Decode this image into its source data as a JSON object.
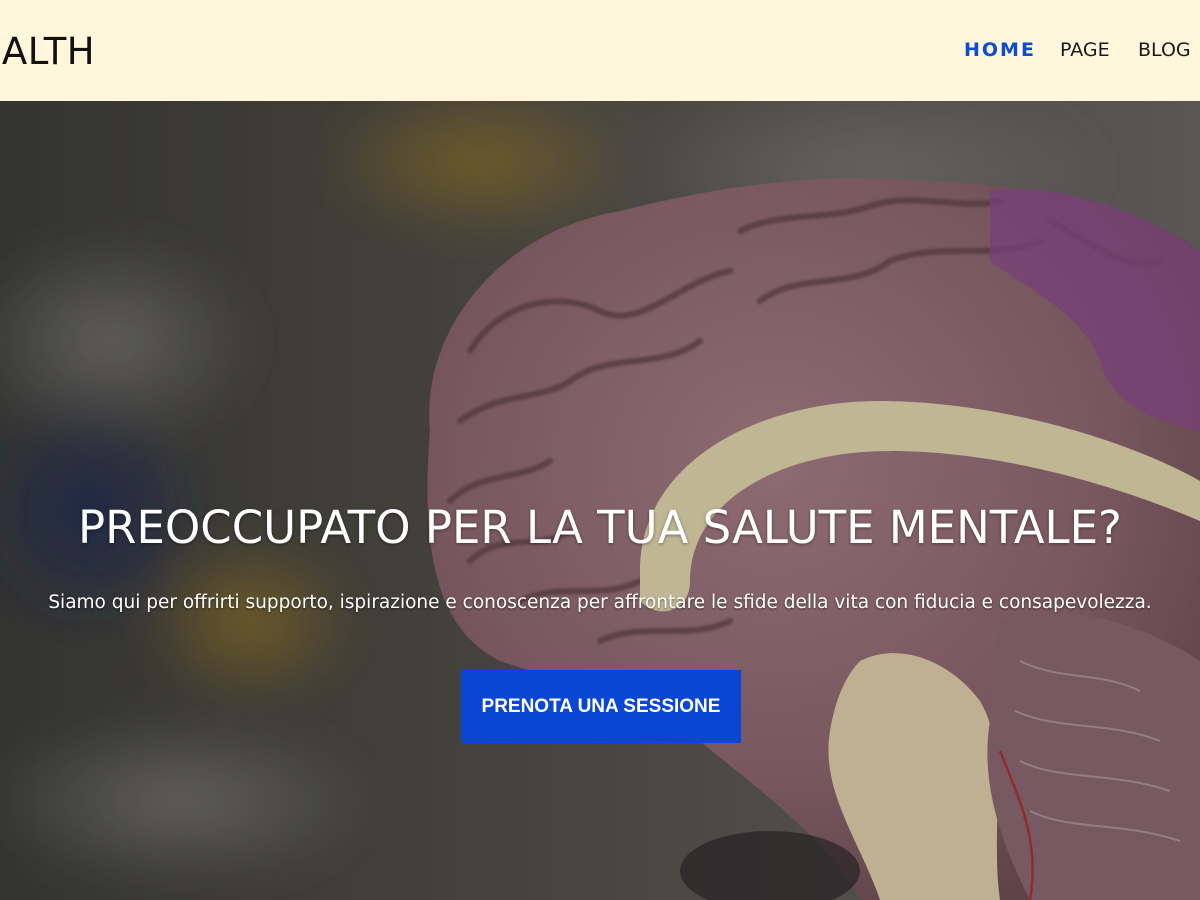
{
  "header": {
    "logo": "EALTH",
    "nav": [
      {
        "label": "HOME",
        "active": true
      },
      {
        "label": "PAGE",
        "active": false
      },
      {
        "label": "BLOG",
        "active": false
      }
    ]
  },
  "hero": {
    "title": "PREOCCUPATO PER LA TUA SALUTE MENTALE?",
    "subtitle": "Siamo qui per offrirti supporto, ispirazione e conoscenza per affrontare le sfide della vita con fiducia e consapevolezza.",
    "cta_label": "PRENOTA UNA SESSIONE",
    "background_image": "brain-model-photo"
  },
  "colors": {
    "header_bg": "#fff6dc",
    "accent": "#0a46d4",
    "active_nav": "#0c4ccf"
  }
}
